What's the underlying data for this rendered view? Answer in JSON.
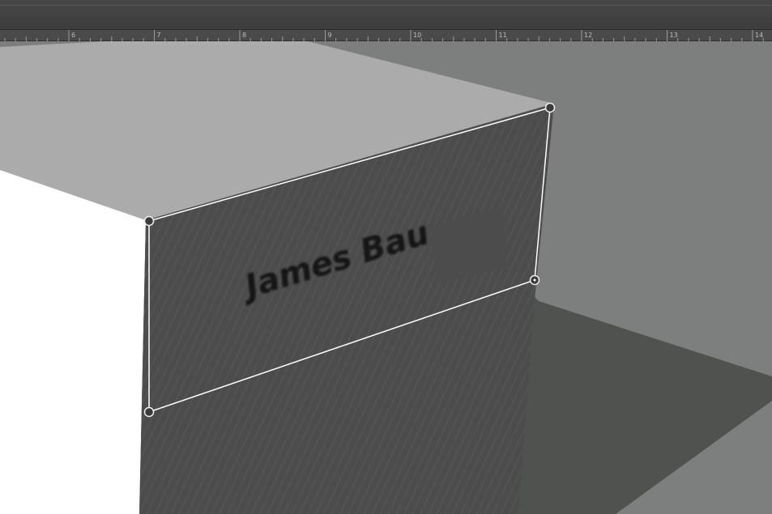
{
  "ruler": {
    "labels": [
      "6",
      "7",
      "8",
      "9",
      "10",
      "11",
      "12",
      "13",
      "14"
    ]
  },
  "artwork": {
    "label_text": "James Bau"
  },
  "colors": {
    "background": "#3c3c3c",
    "ruler": "#4a4a4a",
    "top_face": "#ababab",
    "front_face": "#4c4c4c",
    "left_face": "#ffffff",
    "floor": "#7c7f7d",
    "shadow": "#505250",
    "path": "#ffffff"
  },
  "transform_handles": [
    {
      "name": "top-left-handle"
    },
    {
      "name": "top-right-handle"
    },
    {
      "name": "right-mid-handle"
    },
    {
      "name": "bottom-left-handle"
    }
  ]
}
